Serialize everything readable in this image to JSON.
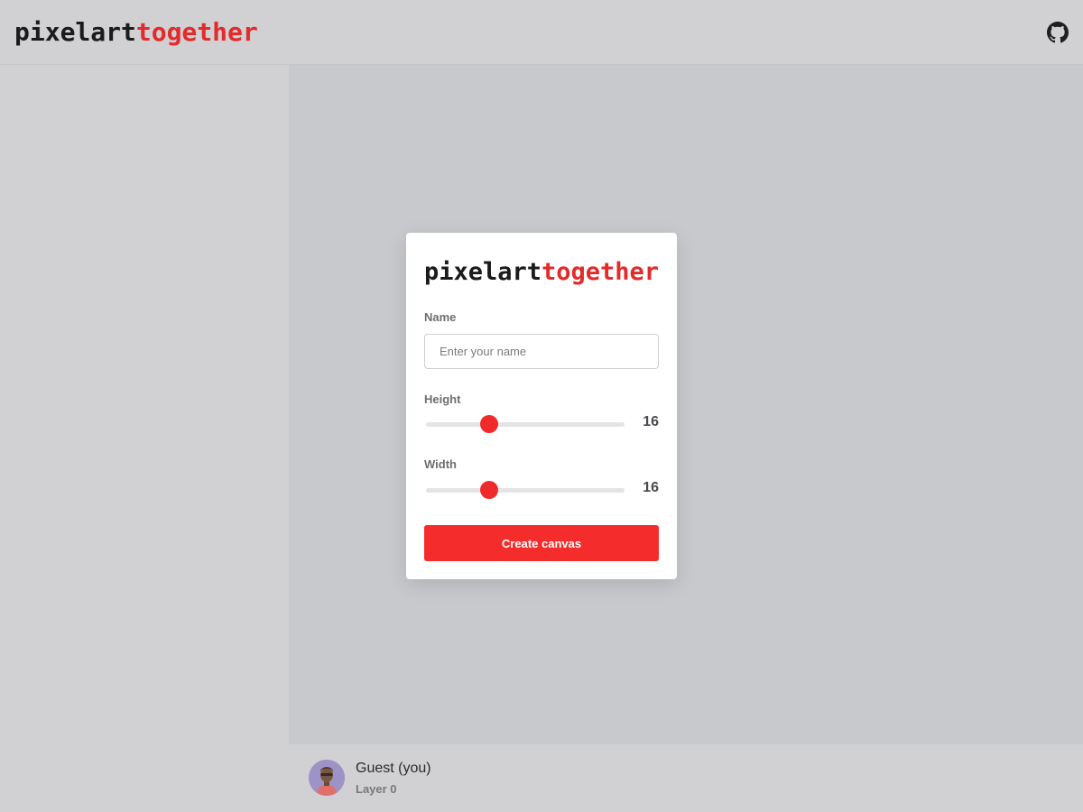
{
  "header": {
    "logo_part1": "pixelart",
    "logo_part2": "together",
    "github_icon": "github-icon"
  },
  "colors": {
    "accent": "#f52c2c",
    "logo_dark": "#1b1b1b",
    "logo_red": "#e32b2b"
  },
  "modal": {
    "logo_part1": "pixelart",
    "logo_part2": "together",
    "name_label": "Name",
    "name_placeholder": "Enter your name",
    "name_value": "",
    "height_label": "Height",
    "height_value": "16",
    "height_level": 0.32,
    "width_label": "Width",
    "width_value": "16",
    "width_level": 0.32,
    "create_label": "Create canvas"
  },
  "user": {
    "name": "Guest (you)",
    "layer": "Layer 0",
    "avatar_icon": "avatar-icon"
  }
}
